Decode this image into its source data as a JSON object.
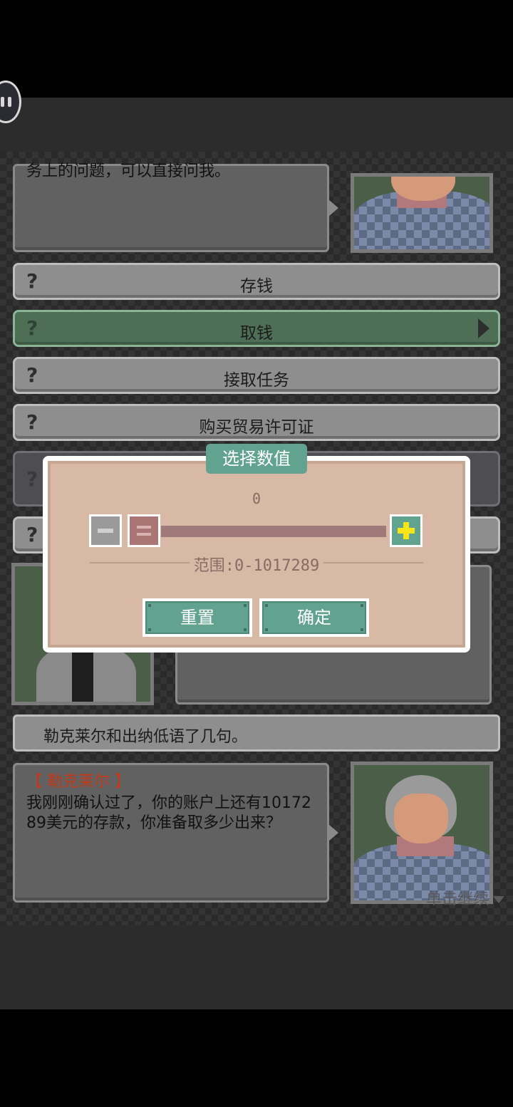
{
  "top_dialog": {
    "text": "务上的问题，可以直接问我。"
  },
  "options": [
    {
      "label": "存钱",
      "icon": "question-mark-icon",
      "selected": false
    },
    {
      "label": "取钱",
      "icon": "question-mark-icon",
      "selected": true
    },
    {
      "label": "接取任务",
      "icon": "question-mark-icon",
      "selected": false
    },
    {
      "label": "购买贸易许可证",
      "icon": "question-mark-icon",
      "selected": false
    }
  ],
  "question_mark": "?",
  "narration": "勒克莱尔和出纳低语了几句。",
  "bottom_dialog": {
    "speaker": "【 勒克莱尔 】",
    "text": "我刚刚确认过了，你的账户上还有1017289美元的存款，你准备取多少出来？"
  },
  "continue_hint": "单击继续",
  "number_picker": {
    "title": "选择数值",
    "current_value": "0",
    "range_text": "范围:0-1017289",
    "min": 0,
    "max": 1017289,
    "reset_label": "重置",
    "confirm_label": "确定"
  },
  "colors": {
    "accent": "#62a38f",
    "dialog_bg": "#d8b9a5",
    "speaker_name": "#c0391b",
    "plus_icon": "#f4e619"
  }
}
